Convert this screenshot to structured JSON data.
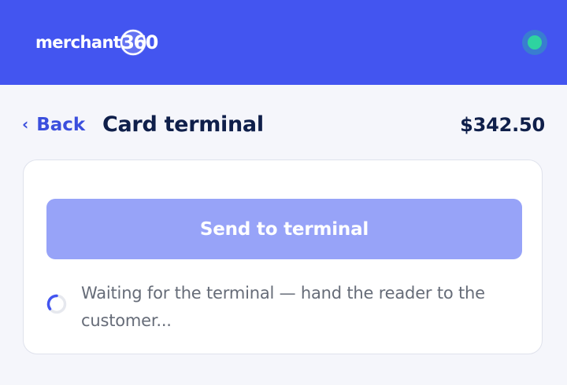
{
  "header": {
    "logo_text": "merchant",
    "logo_number": "360",
    "status_icon": "status-dot-icon",
    "status_color": "#2ed3a0",
    "brand_color": "#4355f0"
  },
  "nav": {
    "back_icon": "chevron-left-icon",
    "back_chevron": "‹",
    "back_label": "Back",
    "title": "Card terminal",
    "amount": "$342.50"
  },
  "panel": {
    "send_button_label": "Send to terminal",
    "spinner_icon": "spinner-icon",
    "waiting_message": "Waiting for the terminal — hand the reader to the customer..."
  }
}
